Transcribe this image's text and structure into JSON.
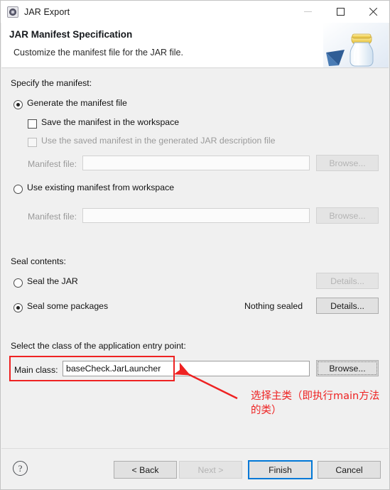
{
  "window": {
    "title": "JAR Export",
    "icon": "jar-export-gear-icon",
    "controls": {
      "minimize": "minimize-icon",
      "maximize": "maximize-icon",
      "close": "close-icon"
    }
  },
  "header": {
    "title": "JAR Manifest Specification",
    "description": "Customize the manifest file for the JAR file.",
    "art": "jar-bottle-icon"
  },
  "manifest_section": {
    "group_label": "Specify the manifest:",
    "generate_radio": {
      "label": "Generate the manifest file",
      "selected": true
    },
    "save_checkbox": {
      "label": "Save the manifest in the workspace",
      "checked": false,
      "enabled": true
    },
    "use_saved_checkbox": {
      "label": "Use the saved manifest in the generated JAR description file",
      "checked": false,
      "enabled": false
    },
    "manifest_file_1": {
      "label": "Manifest file:",
      "value": "",
      "enabled": false
    },
    "browse_1": {
      "label": "Browse...",
      "enabled": false
    },
    "use_existing_radio": {
      "label": "Use existing manifest from workspace",
      "selected": false
    },
    "manifest_file_2": {
      "label": "Manifest file:",
      "value": "",
      "enabled": false
    },
    "browse_2": {
      "label": "Browse...",
      "enabled": false
    }
  },
  "seal_section": {
    "group_label": "Seal contents:",
    "seal_jar_radio": {
      "label": "Seal the JAR",
      "selected": false
    },
    "details_1": {
      "label": "Details...",
      "enabled": false
    },
    "seal_packages_radio": {
      "label": "Seal some packages",
      "selected": true
    },
    "seal_status": "Nothing sealed",
    "details_2": {
      "label": "Details...",
      "enabled": true
    }
  },
  "entry_point_section": {
    "group_label": "Select the class of the application entry point:",
    "main_class_label": "Main class:",
    "main_class_value": "baseCheck.JarLauncher",
    "browse_3": {
      "label": "Browse...",
      "enabled": true
    }
  },
  "footer": {
    "help": "help-icon",
    "back": "< Back",
    "next": "Next >",
    "finish": "Finish",
    "cancel": "Cancel",
    "next_enabled": false,
    "finish_is_default": true
  },
  "annotation": {
    "text": "选择主类（即执行main方法的类）",
    "color": "#ee2222",
    "highlight_target": "main-class-row",
    "arrow": "red-arrow-pointing-to-main-class-field"
  }
}
